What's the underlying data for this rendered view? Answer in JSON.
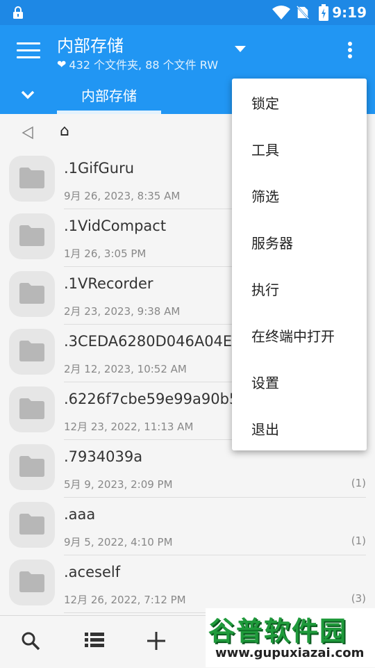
{
  "status": {
    "time": "9:19"
  },
  "appbar": {
    "title": "内部存储",
    "subtitle": "432 个文件夹, 88 个文件 RW"
  },
  "tabs": [
    {
      "label": "内部存储",
      "active": true
    }
  ],
  "breadcrumb": {
    "home_glyph": "⌂"
  },
  "files": [
    {
      "name": ".1GifGuru",
      "date": "9月 26, 2023, 8:35 AM",
      "count": ""
    },
    {
      "name": ".1VidCompact",
      "date": "1月 26, 3:05 PM",
      "count": ""
    },
    {
      "name": ".1VRecorder",
      "date": "2月 23, 2023, 9:38 AM",
      "count": ""
    },
    {
      "name": ".3CEDA6280D046A04EC",
      "date": "2月 12, 2023, 10:52 AM",
      "count": ""
    },
    {
      "name": ".6226f7cbe59e99a90b5",
      "date": "12月 23, 2022, 11:13 AM",
      "count": ""
    },
    {
      "name": ".7934039a",
      "date": "5月 9, 2023, 2:09 PM",
      "count": "(1)"
    },
    {
      "name": ".aaa",
      "date": "9月 5, 2022, 4:10 PM",
      "count": "(1)"
    },
    {
      "name": ".aceself",
      "date": "12月 26, 2022, 7:12 PM",
      "count": "(3)"
    }
  ],
  "menu": {
    "items": [
      "锁定",
      "工具",
      "筛选",
      "服务器",
      "执行",
      "在终端中打开",
      "设置",
      "退出"
    ]
  },
  "watermark": {
    "main": "谷普软件园",
    "sub": "www.gupuxiazai.com"
  },
  "colors": {
    "primary": "#2196f3",
    "statusbar": "#1e88e5",
    "accent_text": "#ffffff"
  },
  "icons": {
    "status": [
      "lock-icon",
      "wifi-icon",
      "no-sim-icon",
      "battery-icon"
    ],
    "bottom": [
      "search-icon",
      "list-view-icon",
      "add-icon"
    ]
  }
}
